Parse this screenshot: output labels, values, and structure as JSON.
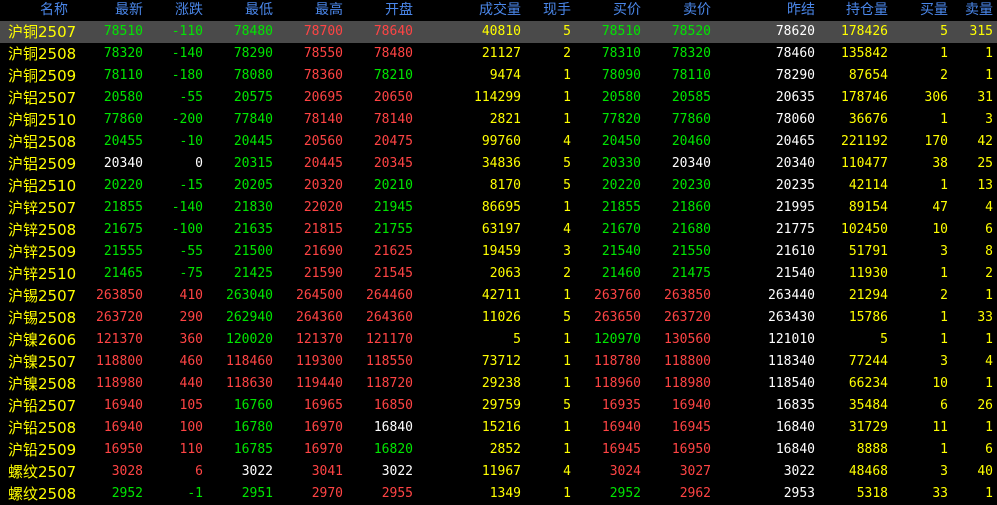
{
  "headers": [
    "名称",
    "最新",
    "涨跌",
    "最低",
    "最高",
    "开盘",
    "成交量",
    "现手",
    "买价",
    "卖价",
    "昨结",
    "持仓量",
    "买量",
    "卖量"
  ],
  "selected_row": 0,
  "rows": [
    [
      "沪铜2507",
      "78510",
      "-110",
      "78480",
      "78700",
      "78640",
      "40810",
      "5",
      "78510",
      "78520",
      "78620",
      "178426",
      "5",
      "315"
    ],
    [
      "沪铜2508",
      "78320",
      "-140",
      "78290",
      "78550",
      "78480",
      "21127",
      "2",
      "78310",
      "78320",
      "78460",
      "135842",
      "1",
      "1"
    ],
    [
      "沪铜2509",
      "78110",
      "-180",
      "78080",
      "78360",
      "78210",
      "9474",
      "1",
      "78090",
      "78110",
      "78290",
      "87654",
      "2",
      "1"
    ],
    [
      "沪铝2507",
      "20580",
      "-55",
      "20575",
      "20695",
      "20650",
      "114299",
      "1",
      "20580",
      "20585",
      "20635",
      "178746",
      "306",
      "31"
    ],
    [
      "沪铜2510",
      "77860",
      "-200",
      "77840",
      "78140",
      "78140",
      "2821",
      "1",
      "77820",
      "77860",
      "78060",
      "36676",
      "1",
      "3"
    ],
    [
      "沪铝2508",
      "20455",
      "-10",
      "20445",
      "20560",
      "20475",
      "99760",
      "4",
      "20450",
      "20460",
      "20465",
      "221192",
      "170",
      "42"
    ],
    [
      "沪铝2509",
      "20340",
      "0",
      "20315",
      "20445",
      "20345",
      "34836",
      "5",
      "20330",
      "20340",
      "20340",
      "110477",
      "38",
      "25"
    ],
    [
      "沪铝2510",
      "20220",
      "-15",
      "20205",
      "20320",
      "20210",
      "8170",
      "5",
      "20220",
      "20230",
      "20235",
      "42114",
      "1",
      "13"
    ],
    [
      "沪锌2507",
      "21855",
      "-140",
      "21830",
      "22020",
      "21945",
      "86695",
      "1",
      "21855",
      "21860",
      "21995",
      "89154",
      "47",
      "4"
    ],
    [
      "沪锌2508",
      "21675",
      "-100",
      "21635",
      "21815",
      "21755",
      "63197",
      "4",
      "21670",
      "21680",
      "21775",
      "102450",
      "10",
      "6"
    ],
    [
      "沪锌2509",
      "21555",
      "-55",
      "21500",
      "21690",
      "21625",
      "19459",
      "3",
      "21540",
      "21550",
      "21610",
      "51791",
      "3",
      "8"
    ],
    [
      "沪锌2510",
      "21465",
      "-75",
      "21425",
      "21590",
      "21545",
      "2063",
      "2",
      "21460",
      "21475",
      "21540",
      "11930",
      "1",
      "2"
    ],
    [
      "沪锡2507",
      "263850",
      "410",
      "263040",
      "264500",
      "264460",
      "42711",
      "1",
      "263760",
      "263850",
      "263440",
      "21294",
      "2",
      "1"
    ],
    [
      "沪锡2508",
      "263720",
      "290",
      "262940",
      "264360",
      "264360",
      "11026",
      "5",
      "263650",
      "263720",
      "263430",
      "15786",
      "1",
      "33"
    ],
    [
      "沪镍2606",
      "121370",
      "360",
      "120020",
      "121370",
      "121170",
      "5",
      "1",
      "120970",
      "130560",
      "121010",
      "5",
      "1",
      "1"
    ],
    [
      "沪镍2507",
      "118800",
      "460",
      "118460",
      "119300",
      "118550",
      "73712",
      "1",
      "118780",
      "118800",
      "118340",
      "77244",
      "3",
      "4"
    ],
    [
      "沪镍2508",
      "118980",
      "440",
      "118630",
      "119440",
      "118720",
      "29238",
      "1",
      "118960",
      "118980",
      "118540",
      "66234",
      "10",
      "1"
    ],
    [
      "沪铅2507",
      "16940",
      "105",
      "16760",
      "16965",
      "16850",
      "29759",
      "5",
      "16935",
      "16940",
      "16835",
      "35484",
      "6",
      "26"
    ],
    [
      "沪铅2508",
      "16940",
      "100",
      "16780",
      "16970",
      "16840",
      "15216",
      "1",
      "16940",
      "16945",
      "16840",
      "31729",
      "11",
      "1"
    ],
    [
      "沪铅2509",
      "16950",
      "110",
      "16785",
      "16970",
      "16820",
      "2852",
      "1",
      "16945",
      "16950",
      "16840",
      "8888",
      "1",
      "6"
    ],
    [
      "螺纹2507",
      "3028",
      "6",
      "3022",
      "3041",
      "3022",
      "11967",
      "4",
      "3024",
      "3027",
      "3022",
      "48468",
      "3",
      "40"
    ],
    [
      "螺纹2508",
      "2952",
      "-1",
      "2951",
      "2970",
      "2955",
      "1349",
      "1",
      "2952",
      "2962",
      "2953",
      "5318",
      "33",
      "1"
    ]
  ]
}
